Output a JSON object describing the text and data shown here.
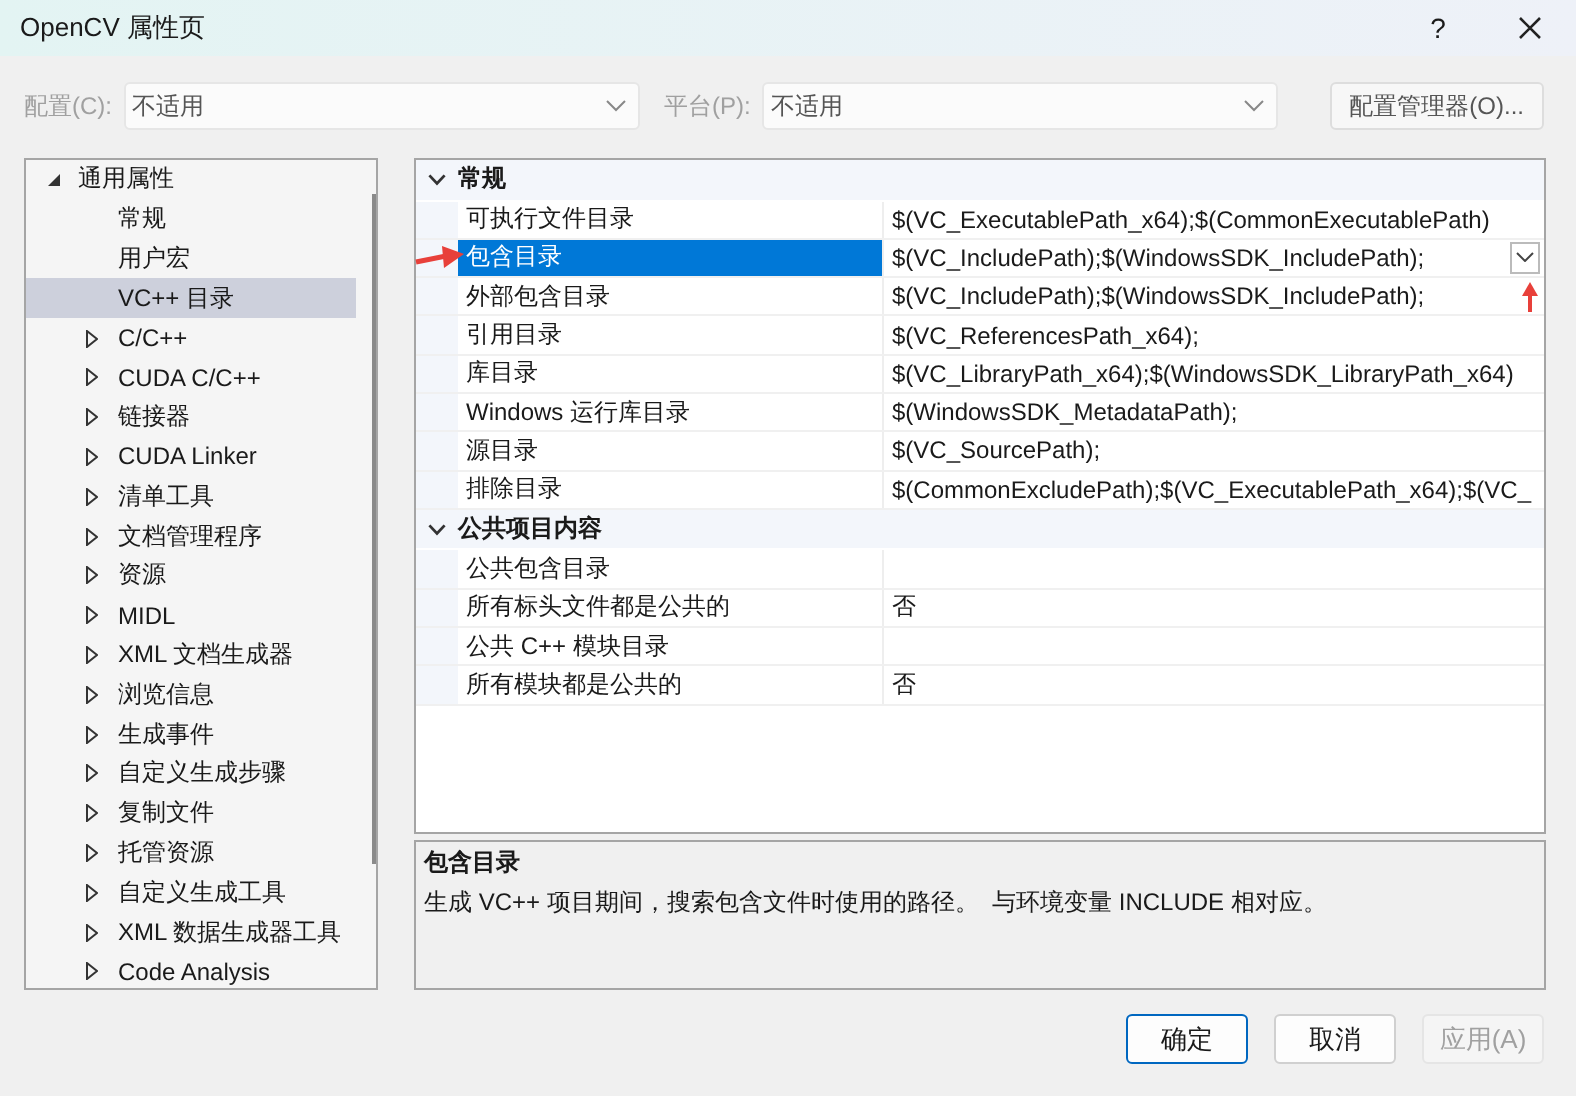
{
  "window": {
    "title": "OpenCV 属性页",
    "help": "?"
  },
  "config_bar": {
    "fields": [
      {
        "label": "配置(C):",
        "value": "不适用",
        "disabled": true
      },
      {
        "label": "平台(P):",
        "value": "不适用",
        "disabled": true
      }
    ],
    "manager_button": "配置管理器(O)..."
  },
  "tree": [
    {
      "label": "通用属性",
      "kind": "group",
      "expanded": true,
      "selected": false,
      "children": [
        {
          "label": "常规",
          "kind": "leaf",
          "selected": false
        },
        {
          "label": "用户宏",
          "kind": "leaf",
          "selected": false
        },
        {
          "label": "VC++ 目录",
          "kind": "leaf",
          "selected": true
        },
        {
          "label": "C/C++",
          "kind": "group",
          "expanded": false,
          "selected": false
        },
        {
          "label": "CUDA C/C++",
          "kind": "group",
          "expanded": false,
          "selected": false
        },
        {
          "label": "链接器",
          "kind": "group",
          "expanded": false,
          "selected": false
        },
        {
          "label": "CUDA Linker",
          "kind": "group",
          "expanded": false,
          "selected": false
        },
        {
          "label": "清单工具",
          "kind": "group",
          "expanded": false,
          "selected": false
        },
        {
          "label": "文档管理程序",
          "kind": "group",
          "expanded": false,
          "selected": false
        },
        {
          "label": "资源",
          "kind": "group",
          "expanded": false,
          "selected": false
        },
        {
          "label": "MIDL",
          "kind": "group",
          "expanded": false,
          "selected": false
        },
        {
          "label": "XML 文档生成器",
          "kind": "group",
          "expanded": false,
          "selected": false
        },
        {
          "label": "浏览信息",
          "kind": "group",
          "expanded": false,
          "selected": false
        },
        {
          "label": "生成事件",
          "kind": "group",
          "expanded": false,
          "selected": false
        },
        {
          "label": "自定义生成步骤",
          "kind": "group",
          "expanded": false,
          "selected": false
        },
        {
          "label": "复制文件",
          "kind": "group",
          "expanded": false,
          "selected": false
        },
        {
          "label": "托管资源",
          "kind": "group",
          "expanded": false,
          "selected": false
        },
        {
          "label": "自定义生成工具",
          "kind": "group",
          "expanded": false,
          "selected": false
        },
        {
          "label": "XML 数据生成器工具",
          "kind": "group",
          "expanded": false,
          "selected": false
        },
        {
          "label": "Code Analysis",
          "kind": "group",
          "expanded": false,
          "selected": false
        }
      ]
    }
  ],
  "property_grid": {
    "categories": [
      {
        "name": "常规",
        "expanded": true,
        "properties": [
          {
            "name": "可执行文件目录",
            "value": "$(VC_ExecutablePath_x64);$(CommonExecutablePath)",
            "selected": false
          },
          {
            "name": "包含目录",
            "value": "$(VC_IncludePath);$(WindowsSDK_IncludePath);",
            "selected": true
          },
          {
            "name": "外部包含目录",
            "value": "$(VC_IncludePath);$(WindowsSDK_IncludePath);",
            "selected": false
          },
          {
            "name": "引用目录",
            "value": "$(VC_ReferencesPath_x64);",
            "selected": false
          },
          {
            "name": "库目录",
            "value": "$(VC_LibraryPath_x64);$(WindowsSDK_LibraryPath_x64)",
            "selected": false
          },
          {
            "name": "Windows 运行库目录",
            "value": "$(WindowsSDK_MetadataPath);",
            "selected": false
          },
          {
            "name": "源目录",
            "value": "$(VC_SourcePath);",
            "selected": false
          },
          {
            "name": "排除目录",
            "value": "$(CommonExcludePath);$(VC_ExecutablePath_x64);$(VC_",
            "selected": false
          }
        ]
      },
      {
        "name": "公共项目内容",
        "expanded": true,
        "properties": [
          {
            "name": "公共包含目录",
            "selected": false
          },
          {
            "name": "所有标头文件都是公共的",
            "value": "否",
            "selected": false
          },
          {
            "name": "公共 C++ 模块目录",
            "selected": false
          },
          {
            "name": "所有模块都是公共的",
            "value": "否",
            "selected": false
          }
        ]
      }
    ]
  },
  "description": {
    "title": "包含目录",
    "text": "生成 VC++ 项目期间，搜索包含文件时使用的路径。  与环境变量 INCLUDE 相对应。"
  },
  "buttons": [
    {
      "label": "确定",
      "kind": "primary",
      "disabled": false
    },
    {
      "label": "取消",
      "kind": "default",
      "disabled": false
    },
    {
      "label": "应用(A)",
      "kind": "default",
      "disabled": true
    }
  ]
}
